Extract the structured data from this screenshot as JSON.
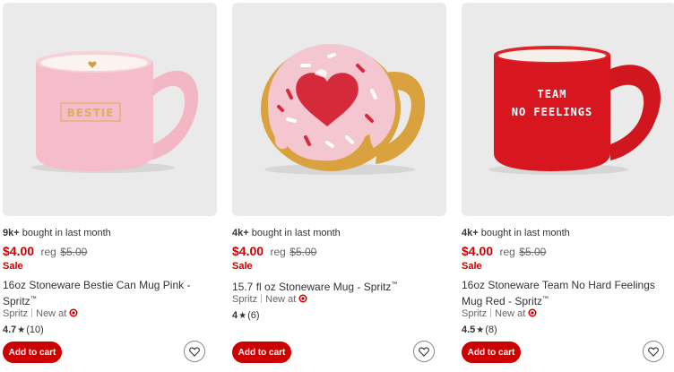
{
  "products": [
    {
      "bought_count": "9k+",
      "bought_suffix": "bought in last month",
      "price": "$4.00",
      "reg_label": "reg",
      "reg_price": "$5.00",
      "sale_label": "Sale",
      "title": "16oz Stoneware Bestie Can Mug Pink - Spritz",
      "trademark": "™",
      "brand": "Spritz",
      "new_at": "New at",
      "rating": "4.7",
      "rating_stars": 4.7,
      "reviews": "(10)",
      "mug_text": "BESTIE",
      "add_to_cart": "Add to cart",
      "heart_icon": "heart-outline-icon"
    },
    {
      "bought_count": "4k+",
      "bought_suffix": "bought in last month",
      "price": "$4.00",
      "reg_label": "reg",
      "reg_price": "$5.00",
      "sale_label": "Sale",
      "title": "15.7 fl oz Stoneware Mug - Spritz",
      "trademark": "™",
      "brand": "Spritz",
      "new_at": "New at",
      "rating": "4",
      "rating_stars": 4,
      "reviews": "(6)",
      "add_to_cart": "Add to cart",
      "heart_icon": "heart-outline-icon"
    },
    {
      "bought_count": "4k+",
      "bought_suffix": "bought in last month",
      "price": "$4.00",
      "reg_label": "reg",
      "reg_price": "$5.00",
      "sale_label": "Sale",
      "title": "16oz Stoneware Team No Hard Feelings Mug Red - Spritz",
      "trademark": "™",
      "brand": "Spritz",
      "new_at": "New at",
      "rating": "4.5",
      "rating_stars": 4.5,
      "reviews": "(8)",
      "mug_text_line1": "TEAM",
      "mug_text_line2": "NO FEELINGS",
      "add_to_cart": "Add to cart",
      "heart_icon": "heart-outline-icon"
    }
  ],
  "colors": {
    "price_red": "#cc0000",
    "button_red": "#cc0000",
    "image_bg": "#eaeaea",
    "text": "#333333",
    "muted": "#666666"
  }
}
